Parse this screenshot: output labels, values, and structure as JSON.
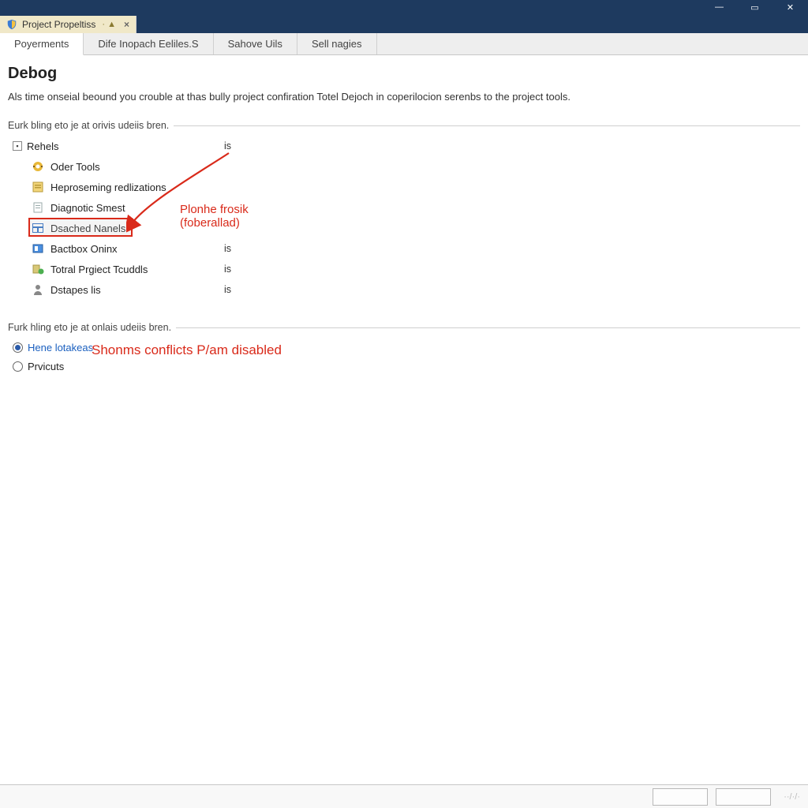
{
  "titlebar": {},
  "doctab": {
    "label": "Project Propeltiss",
    "extras": "· ▲",
    "close": "×"
  },
  "navtabs": [
    "Poyerments",
    "Dife Inopach Eeliles.S",
    "Sahove Uils",
    "Sell nagies"
  ],
  "page": {
    "heading": "Debog",
    "desc": "Als time onseial beound you crouble at thas bully project confiration Totel Dejoch in coperilocion serenbs to the project tools.",
    "group1_label": "Eurk bling eto je at orivis udeiis bren.",
    "group2_label": "Furk hling eto je at onlais udeiis bren."
  },
  "tree_root": {
    "label": "Rehels",
    "val": "is"
  },
  "tree_items": [
    {
      "label": "Oder Tools",
      "val": "",
      "icon": "gear"
    },
    {
      "label": "Heproseming redlizations",
      "val": "",
      "icon": "doc-yellow"
    },
    {
      "label": "Diagnotic Smest",
      "val": "",
      "icon": "page"
    },
    {
      "label": "Dsached Nanels",
      "val": "",
      "icon": "table-blue",
      "selected": true
    },
    {
      "label": "Bactbox Oninx",
      "val": "is",
      "icon": "panel-blue"
    },
    {
      "label": "Totral Prgiect Tcuddls",
      "val": "is",
      "icon": "gear-green"
    },
    {
      "label": "Dstapes lis",
      "val": "is",
      "icon": "person"
    }
  ],
  "radios": {
    "opt1": "Hene lotakeas",
    "opt2": "Prvicuts"
  },
  "annotations": {
    "arrow_label_line1": "Plonhe frosik",
    "arrow_label_line2": "(foberallad)",
    "disabled_text": "Shonms conflicts P/am disabled"
  },
  "statusbar": {
    "btn1": "",
    "btn2": "",
    "trail": "··/·/·"
  }
}
